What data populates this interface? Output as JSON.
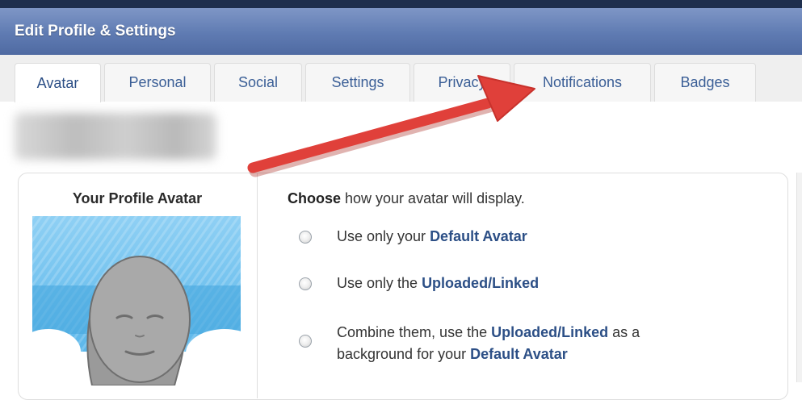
{
  "header": {
    "title": "Edit Profile & Settings"
  },
  "tabs": [
    {
      "label": "Avatar"
    },
    {
      "label": "Personal"
    },
    {
      "label": "Social"
    },
    {
      "label": "Settings"
    },
    {
      "label": "Privacy"
    },
    {
      "label": "Notifications"
    },
    {
      "label": "Badges"
    }
  ],
  "avatar_panel": {
    "title": "Your Profile Avatar"
  },
  "display_options": {
    "prompt_bold": "Choose",
    "prompt_rest": " how your avatar will display.",
    "options": [
      {
        "pre": "Use only your ",
        "bold": "Default Avatar"
      },
      {
        "pre": "Use only the ",
        "bold": "Uploaded/Linked"
      },
      {
        "line1_pre": "Combine them, use the ",
        "line1_bold": "Uploaded/Linked",
        "line1_post": " as a",
        "line2_pre": "background for your ",
        "line2_bold": "Default Avatar"
      }
    ]
  },
  "colors": {
    "header": "#5f7bb2",
    "link_blue": "#2c4f86",
    "annotation_arrow": "#e0403a"
  }
}
